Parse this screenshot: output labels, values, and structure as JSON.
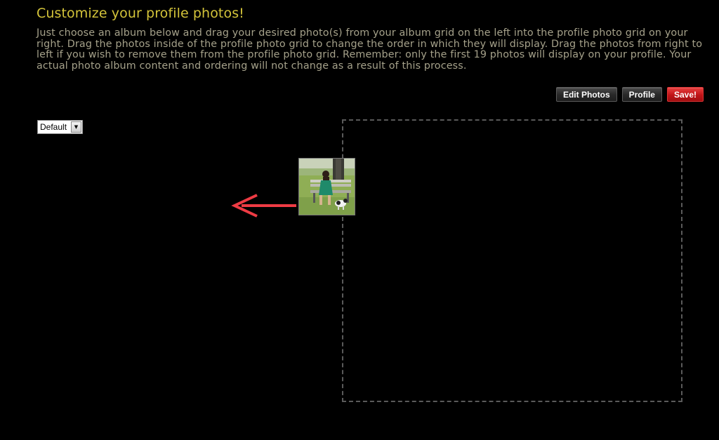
{
  "header": {
    "title": "Customize your profile photos!",
    "instructions": "Just choose an album below and drag your desired photo(s) from your album grid on the left into the profile photo grid on your right. Drag the photos inside of the profile photo grid to change the order in which they will display. Drag the photos from right to left if you wish to remove them from the profile photo grid. Remember: only the first 19 photos will display on your profile. Your actual photo album content and ordering will not change as a result of this process."
  },
  "toolbar": {
    "edit_photos_label": "Edit Photos",
    "profile_label": "Profile",
    "save_label": "Save!"
  },
  "album_select": {
    "selected": "Default"
  },
  "icons": {
    "drag_arrow": "arrow-left-icon",
    "select_arrow": "chevron-down-icon"
  },
  "colors": {
    "background": "#000000",
    "title": "#d4c43a",
    "instructions": "#a5a18a",
    "save_button": "#c01418",
    "drag_arrow": "#ee3b44",
    "grid_border": "#5a5a5a"
  }
}
